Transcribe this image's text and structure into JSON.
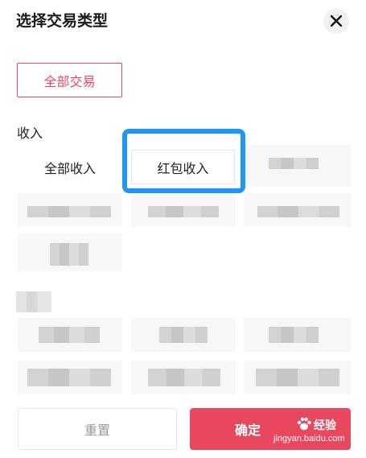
{
  "header": {
    "title": "选择交易类型",
    "close_icon": "close-icon"
  },
  "all_transactions": {
    "label": "全部交易"
  },
  "income": {
    "section_label": "收入",
    "chips": [
      {
        "label": "全部收入"
      },
      {
        "label": "红包收入"
      }
    ]
  },
  "footer": {
    "reset_label": "重置",
    "confirm_label": "确定"
  },
  "watermark": {
    "brand_text": "经验",
    "url": "jingyan.baidu.com"
  },
  "colors": {
    "accent": "#e8485f",
    "highlight": "#1e98f4"
  }
}
